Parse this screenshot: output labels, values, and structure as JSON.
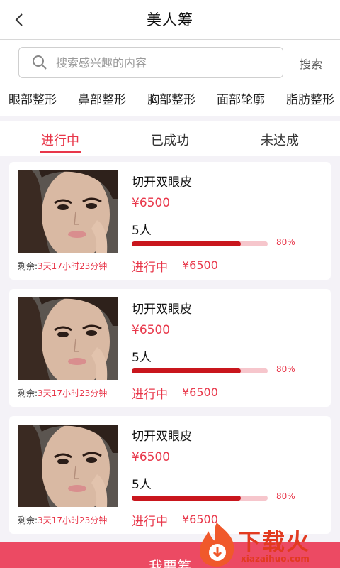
{
  "header": {
    "title": "美人筹"
  },
  "search": {
    "placeholder": "搜索感兴趣的内容",
    "button_label": "搜索"
  },
  "categories": [
    "眼部整形",
    "鼻部整形",
    "胸部整形",
    "面部轮廓",
    "脂肪整形"
  ],
  "tabs": [
    {
      "label": "进行中",
      "active": true
    },
    {
      "label": "已成功",
      "active": false
    },
    {
      "label": "未达成",
      "active": false
    }
  ],
  "colors": {
    "accent": "#e8374a",
    "progress": "#c9161d",
    "progress_track": "#f6c6cc",
    "bottom_bar": "#ec4a63"
  },
  "cards": [
    {
      "name": "切开双眼皮",
      "price": "¥6500",
      "count": "5人",
      "progress": 0.8,
      "progress_label": "80%",
      "remain_label": "剩余:",
      "remain_value": "3天17小时23分钟",
      "status": "进行中",
      "status_price": "¥6500"
    },
    {
      "name": "切开双眼皮",
      "price": "¥6500",
      "count": "5人",
      "progress": 0.8,
      "progress_label": "80%",
      "remain_label": "剩余:",
      "remain_value": "3天17小时23分钟",
      "status": "进行中",
      "status_price": "¥6500"
    },
    {
      "name": "切开双眼皮",
      "price": "¥6500",
      "count": "5人",
      "progress": 0.8,
      "progress_label": "80%",
      "remain_label": "剩余:",
      "remain_value": "3天17小时23分钟",
      "status": "进行中",
      "status_price": "¥6500"
    }
  ],
  "bottom": {
    "button_label": "我要筹"
  },
  "watermark": {
    "text": "下载火",
    "url": "xiazaihuo.com"
  }
}
